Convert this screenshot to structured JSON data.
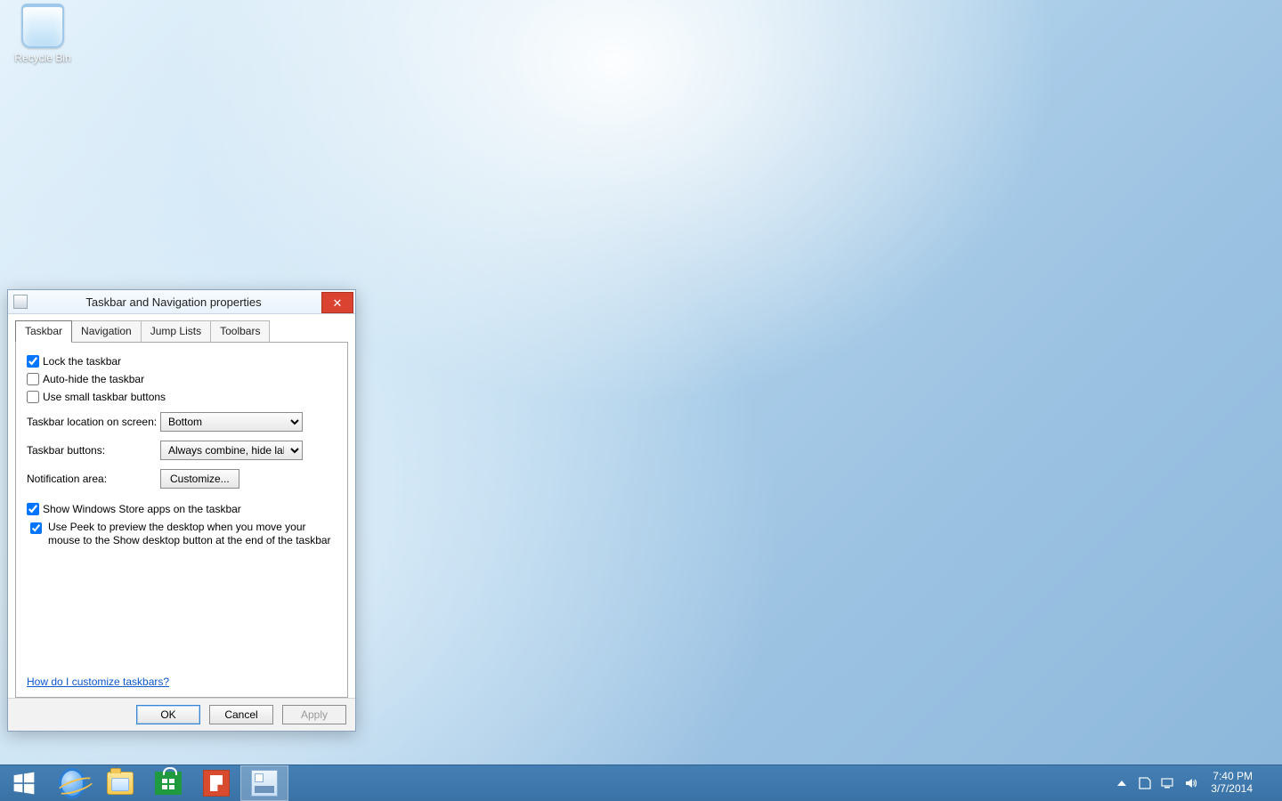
{
  "desktop": {
    "recycle_bin_label": "Recycle Bin"
  },
  "dialog": {
    "title": "Taskbar and Navigation properties",
    "tabs": [
      "Taskbar",
      "Navigation",
      "Jump Lists",
      "Toolbars"
    ],
    "active_tab_index": 0,
    "options": {
      "lock_taskbar": {
        "label": "Lock the taskbar",
        "checked": true
      },
      "auto_hide": {
        "label": "Auto-hide the taskbar",
        "checked": false
      },
      "small_buttons": {
        "label": "Use small taskbar buttons",
        "checked": false
      },
      "show_store_apps": {
        "label": "Show Windows Store apps on the taskbar",
        "checked": true
      },
      "use_peek": {
        "label": "Use Peek to preview the desktop when you move your mouse to the Show desktop button at the end of the taskbar",
        "checked": true
      }
    },
    "rows": {
      "location_label": "Taskbar location on screen:",
      "location_value": "Bottom",
      "buttons_label": "Taskbar buttons:",
      "buttons_value": "Always combine, hide labels",
      "notif_label": "Notification area:",
      "customize_btn": "Customize..."
    },
    "help_link": "How do I customize taskbars?",
    "footer": {
      "ok": "OK",
      "cancel": "Cancel",
      "apply": "Apply",
      "apply_enabled": false
    }
  },
  "taskbar": {
    "system_tray": {
      "time": "7:40 PM",
      "date": "3/7/2014"
    }
  }
}
